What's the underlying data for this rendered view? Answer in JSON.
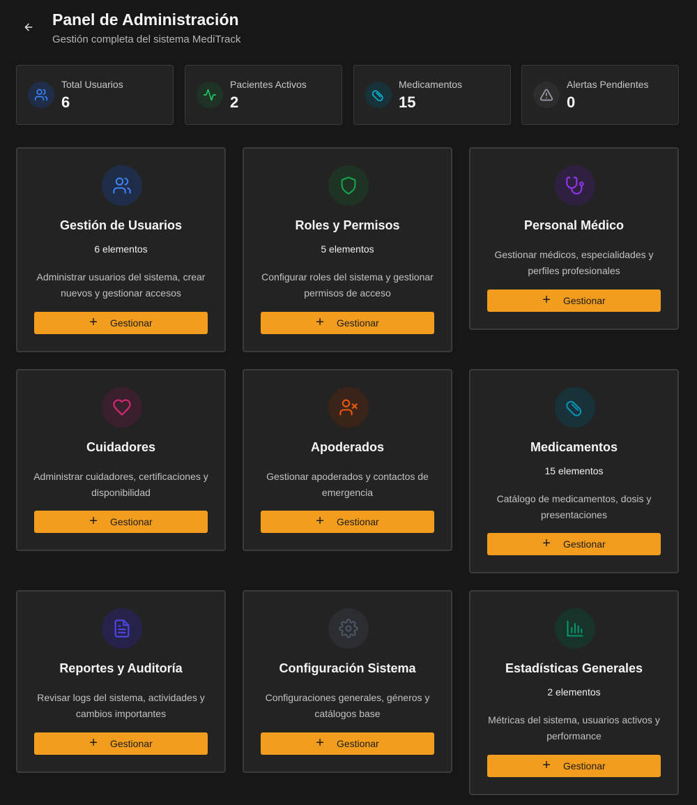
{
  "header": {
    "title": "Panel de Administración",
    "subtitle": "Gestión completa del sistema MediTrack",
    "back_icon": "arrow-left-icon"
  },
  "stats": [
    {
      "label": "Total Usuarios",
      "value": "6",
      "icon": "users-icon",
      "color": "#3b82f6"
    },
    {
      "label": "Pacientes Activos",
      "value": "2",
      "icon": "activity-icon",
      "color": "#22c55e"
    },
    {
      "label": "Medicamentos",
      "value": "15",
      "icon": "pill-icon",
      "color": "#06b6d4"
    },
    {
      "label": "Alertas Pendientes",
      "value": "0",
      "icon": "alert-triangle-icon",
      "color": "#9ca3af"
    }
  ],
  "cards": [
    {
      "title": "Gestión de Usuarios",
      "count": "6 elementos",
      "description": "Administrar usuarios del sistema, crear nuevos y gestionar accesos",
      "button": "Gestionar",
      "icon": "users-icon",
      "color": "#3b82f6"
    },
    {
      "title": "Roles y Permisos",
      "count": "5 elementos",
      "description": "Configurar roles del sistema y gestionar permisos de acceso",
      "button": "Gestionar",
      "icon": "shield-icon",
      "color": "#16a34a"
    },
    {
      "title": "Personal Médico",
      "description": "Gestionar médicos, especialidades y perfiles profesionales",
      "button": "Gestionar",
      "icon": "stethoscope-icon",
      "color": "#9333ea"
    },
    {
      "title": "Cuidadores",
      "description": "Administrar cuidadores, certificaciones y disponibilidad",
      "button": "Gestionar",
      "icon": "heart-icon",
      "color": "#db2777"
    },
    {
      "title": "Apoderados",
      "description": "Gestionar apoderados y contactos de emergencia",
      "button": "Gestionar",
      "icon": "user-x-icon",
      "color": "#ea580c"
    },
    {
      "title": "Medicamentos",
      "count": "15 elementos",
      "description": "Catálogo de medicamentos, dosis y presentaciones",
      "button": "Gestionar",
      "icon": "pill-icon",
      "color": "#0891b2"
    },
    {
      "title": "Reportes y Auditoría",
      "description": "Revisar logs del sistema, actividades y cambios importantes",
      "button": "Gestionar",
      "icon": "file-text-icon",
      "color": "#4f46e5"
    },
    {
      "title": "Configuración Sistema",
      "description": "Configuraciones generales, géneros y catálogos base",
      "button": "Gestionar",
      "icon": "settings-icon",
      "color": "#4b5563"
    },
    {
      "title": "Estadísticas Generales",
      "count": "2 elementos",
      "description": "Métricas del sistema, usuarios activos y performance",
      "button": "Gestionar",
      "icon": "bar-chart-icon",
      "color": "#059669"
    }
  ],
  "colors": {
    "background": "#171717",
    "card": "#232323",
    "border": "#3b3b3b",
    "accent": "#f29d1e"
  }
}
